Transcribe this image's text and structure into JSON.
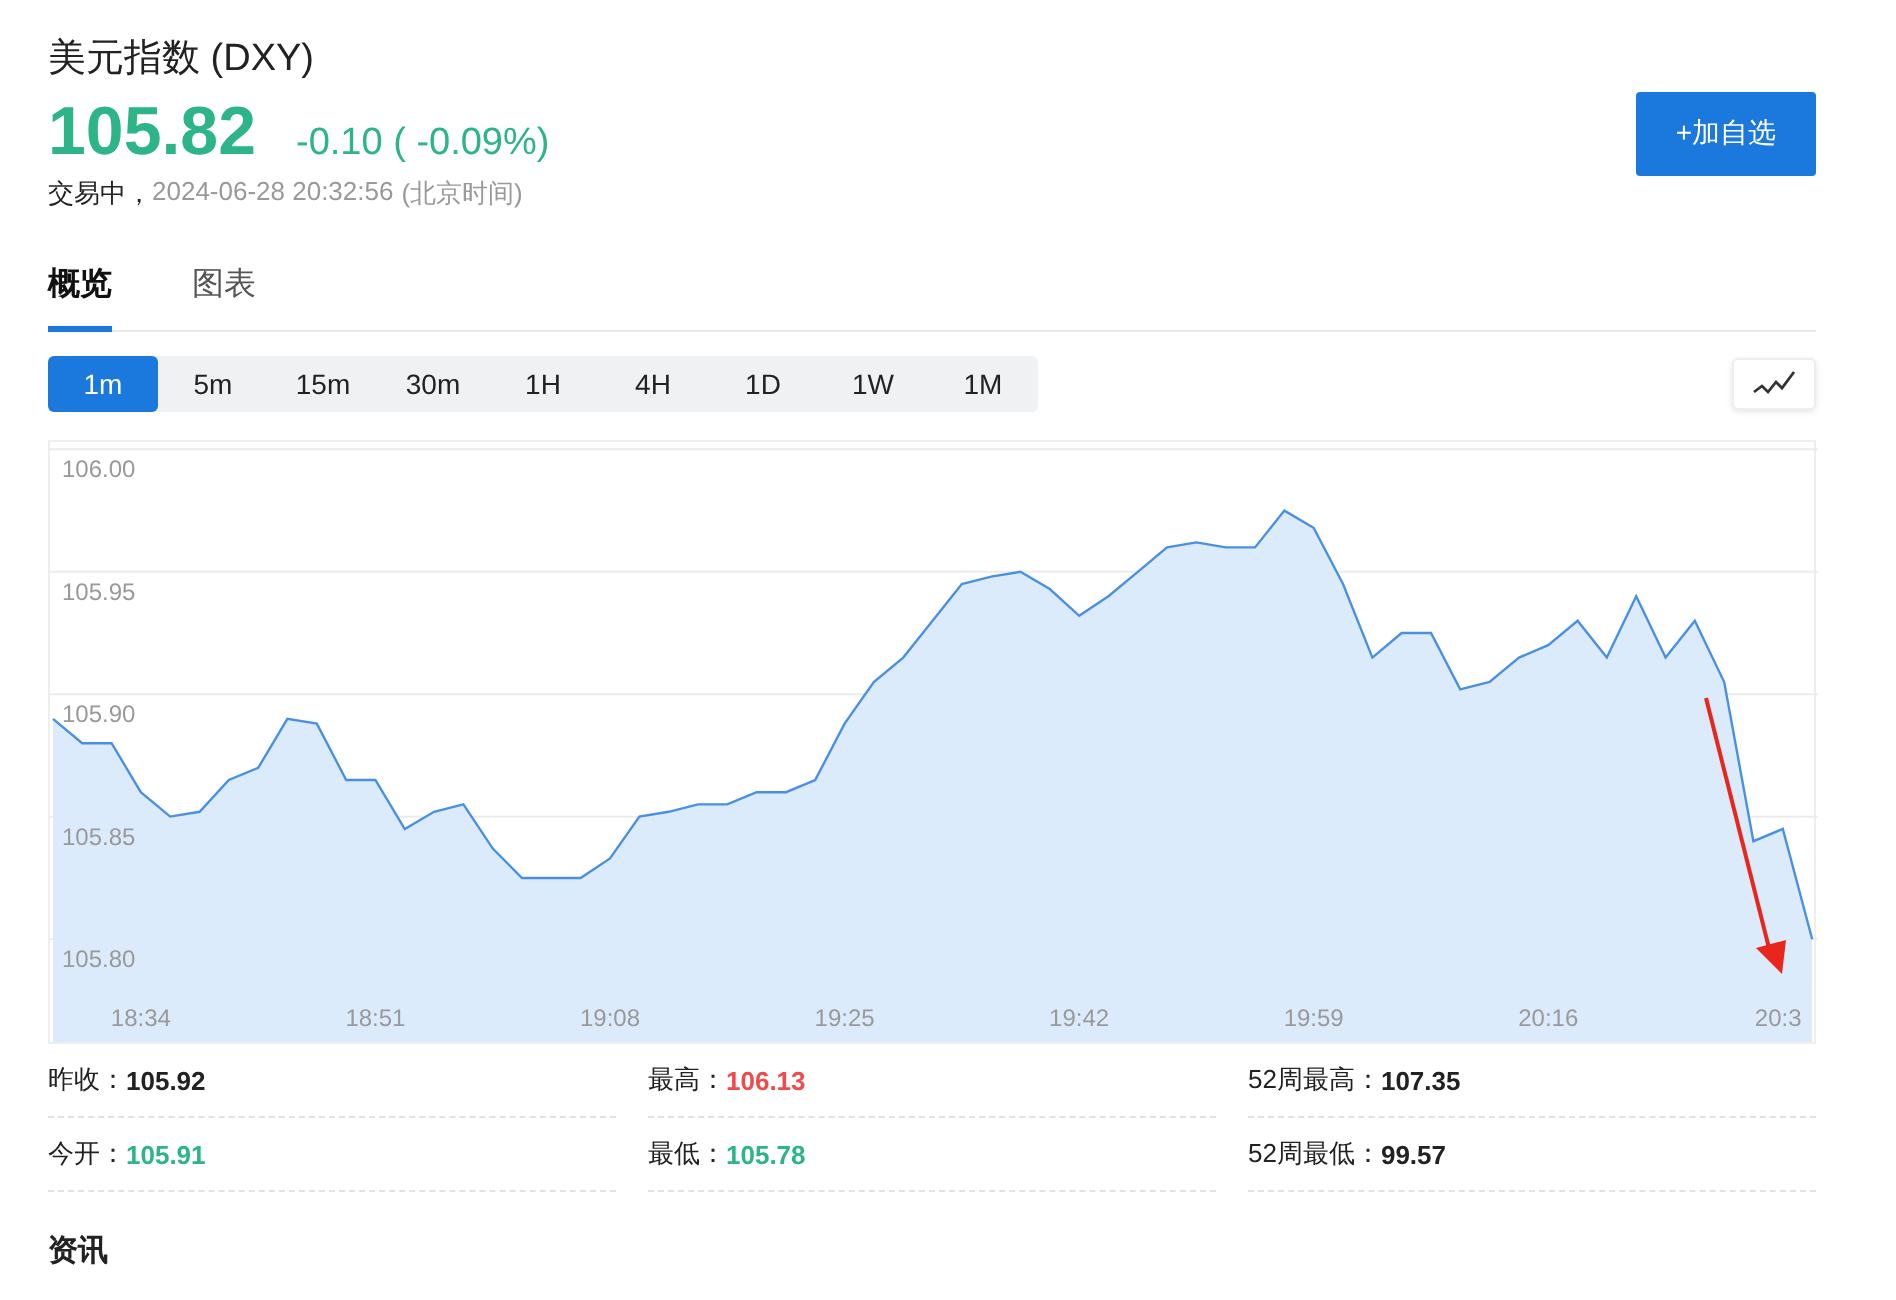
{
  "header": {
    "title": "美元指数 (DXY)",
    "price": "105.82",
    "change": "-0.10 ( -0.09%)",
    "color": "#2db487",
    "status": "交易中，",
    "time": "2024-06-28 20:32:56",
    "timezone": "(北京时间)",
    "add_button": "+加自选"
  },
  "tabs": [
    {
      "label": "概览",
      "selected": true
    },
    {
      "label": "图表",
      "selected": false
    }
  ],
  "periods": [
    {
      "label": "1m",
      "selected": true
    },
    {
      "label": "5m",
      "selected": false
    },
    {
      "label": "15m",
      "selected": false
    },
    {
      "label": "30m",
      "selected": false
    },
    {
      "label": "1H",
      "selected": false
    },
    {
      "label": "4H",
      "selected": false
    },
    {
      "label": "1D",
      "selected": false
    },
    {
      "label": "1W",
      "selected": false
    },
    {
      "label": "1M",
      "selected": false
    }
  ],
  "chart": {
    "chart_data": {
      "type": "area",
      "categories": [
        null,
        null,
        null,
        "18:34",
        null,
        null,
        null,
        null,
        null,
        null,
        null,
        "18:51",
        null,
        null,
        null,
        null,
        null,
        null,
        null,
        "19:08",
        null,
        null,
        null,
        null,
        null,
        null,
        null,
        "19:25",
        null,
        null,
        null,
        null,
        null,
        null,
        null,
        "19:42",
        null,
        null,
        null,
        null,
        null,
        null,
        null,
        "19:59",
        null,
        null,
        null,
        null,
        null,
        null,
        null,
        "20:16",
        null,
        null,
        null,
        null,
        null,
        null,
        null,
        "20:3",
        null
      ],
      "series": [
        {
          "color": "#4a90e2",
          "values": [
            105.89,
            105.88,
            105.88,
            105.86,
            105.85,
            105.852,
            105.865,
            105.87,
            105.89,
            105.888,
            105.865,
            105.865,
            105.845,
            105.852,
            105.855,
            105.837,
            105.825,
            105.825,
            105.825,
            105.833,
            105.85,
            105.852,
            105.855,
            105.855,
            105.86,
            105.86,
            105.865,
            105.888,
            105.905,
            105.915,
            105.93,
            105.945,
            105.948,
            105.95,
            105.943,
            105.932,
            105.94,
            105.95,
            105.96,
            105.962,
            105.96,
            105.96,
            105.975,
            105.968,
            105.945,
            105.915,
            105.925,
            105.925,
            105.902,
            105.905,
            105.915,
            105.92,
            105.93,
            105.915,
            105.94,
            105.915,
            105.93,
            105.905,
            105.84,
            105.845,
            105.8
          ]
        }
      ],
      "ylim": [
        105.758,
        106.003
      ],
      "grid": true,
      "yticks": [
        {
          "value": 106,
          "label": "106.00"
        },
        {
          "value": 105.95,
          "label": "105.95"
        },
        {
          "value": 105.9,
          "label": "105.90"
        },
        {
          "value": 105.85,
          "label": "105.85"
        },
        {
          "value": 105.8,
          "label": "105.80"
        }
      ]
    }
  },
  "stats": [
    {
      "label": "昨收：",
      "value": "105.92",
      "color": "#222222"
    },
    {
      "label": "最高：",
      "value": "106.13",
      "color": "#f04b4b"
    },
    {
      "label": "52周最高：",
      "value": "107.35",
      "color": "#222222"
    },
    {
      "label": "今开：",
      "value": "105.91",
      "color": "#2db487"
    },
    {
      "label": "最低：",
      "value": "105.78",
      "color": "#2db487"
    },
    {
      "label": "52周最低：",
      "value": "99.57",
      "color": "#222222"
    }
  ],
  "section_title": "资讯"
}
